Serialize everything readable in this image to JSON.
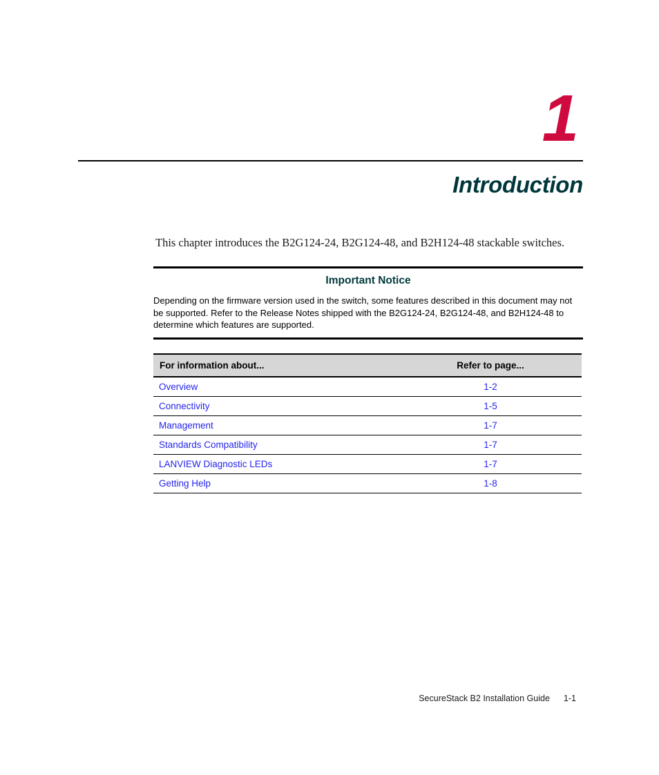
{
  "chapter": {
    "number": "1",
    "title": "Introduction",
    "number_color": "#CE0A3F",
    "title_color": "#00373B"
  },
  "intro": {
    "paragraph": "This chapter introduces the B2G124-24, B2G124-48, and B2H124-48 stackable switches."
  },
  "notice": {
    "title": "Important Notice",
    "body": "Depending on the firmware version used in the switch, some features described in this document may not be supported. Refer to the Release Notes shipped with the B2G124-24, B2G124-48, and B2H124-48 to determine which features are supported.",
    "title_color": "#00393C"
  },
  "refer_table": {
    "header": {
      "topic": "For information about...",
      "page": "Refer to page..."
    },
    "header_bg": "#D6D6D6",
    "link_color": "#2424EE",
    "rows": [
      {
        "topic": "Overview",
        "page": "1-2"
      },
      {
        "topic": "Connectivity",
        "page": "1-5"
      },
      {
        "topic": "Management",
        "page": "1-7"
      },
      {
        "topic": "Standards Compatibility",
        "page": "1-7"
      },
      {
        "topic": "LANVIEW Diagnostic LEDs",
        "page": "1-7"
      },
      {
        "topic": "Getting Help",
        "page": "1-8"
      }
    ]
  },
  "footer": {
    "guide": "SecureStack B2 Installation Guide",
    "page": "1-1"
  }
}
